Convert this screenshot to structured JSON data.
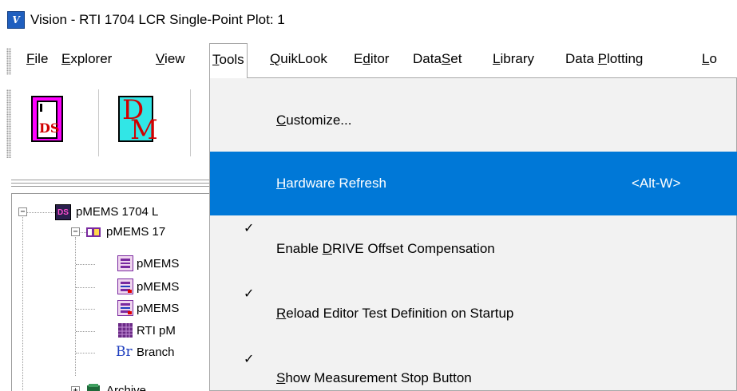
{
  "window": {
    "title": "Vision - RTI 1704 LCR Single-Point Plot: 1",
    "app_icon_text": "V"
  },
  "menubar": {
    "items": [
      {
        "pre": "",
        "u": "F",
        "post": "ile"
      },
      {
        "pre": "",
        "u": "E",
        "post": "xplorer"
      },
      {
        "pre": "",
        "u": "V",
        "post": "iew"
      },
      {
        "pre": "",
        "u": "T",
        "post": "ools"
      },
      {
        "pre": "",
        "u": "Q",
        "post": "uikLook"
      },
      {
        "pre": "E",
        "u": "d",
        "post": "itor"
      },
      {
        "pre": "Data",
        "u": "S",
        "post": "et"
      },
      {
        "pre": "",
        "u": "L",
        "post": "ibrary"
      },
      {
        "pre": "Data ",
        "u": "P",
        "post": "lotting"
      },
      {
        "pre": "",
        "u": "L",
        "post": "o"
      }
    ],
    "active": "Tools"
  },
  "toolbar": {
    "ds_icon_text": "DS",
    "dm_icon_top": "D",
    "dm_icon_bottom": "M"
  },
  "tree": {
    "items": [
      {
        "label": "pMEMS 1704 L",
        "icon": "dataset-icon",
        "expander": "−"
      },
      {
        "label": "pMEMS 17",
        "icon": "test-folder-icon",
        "expander": "−"
      },
      {
        "label": "pMEMS",
        "icon": "measure-task-icon"
      },
      {
        "label": "pMEMS",
        "icon": "measure-task-icon"
      },
      {
        "label": "pMEMS",
        "icon": "measure-task-icon"
      },
      {
        "label": "RTI pM",
        "icon": "plot-grid-icon"
      },
      {
        "label": "Branch",
        "icon": "branch-icon",
        "icon_text": "Br"
      },
      {
        "label": "Archive",
        "icon": "archive-icon",
        "expander": "+"
      }
    ],
    "ds_badge": "DS"
  },
  "tools_menu": {
    "items": [
      {
        "pre": "",
        "u": "C",
        "post": "ustomize...",
        "shortcut": "",
        "checked": false,
        "highlighted": false
      },
      {
        "pre": "",
        "u": "H",
        "post": "ardware Refresh",
        "shortcut": "<Alt-W>",
        "checked": false,
        "highlighted": true
      },
      {
        "pre": "Enable ",
        "u": "D",
        "post": "RIVE Offset Compensation",
        "shortcut": "",
        "checked": true,
        "highlighted": false
      },
      {
        "pre": "",
        "u": "R",
        "post": "eload Editor Test Definition on Startup",
        "shortcut": "",
        "checked": true,
        "highlighted": false
      },
      {
        "pre": "",
        "u": "S",
        "post": "how Measurement Stop Button",
        "shortcut": "",
        "checked": true,
        "highlighted": false
      }
    ],
    "check_glyph": "✓"
  },
  "colors": {
    "highlight": "#0078d7",
    "menu_bg": "#f2f2f2",
    "ds_icon_bg": "#ff00ff",
    "dm_icon_bg": "#31e6e6",
    "icon_text_red": "#d00000"
  }
}
